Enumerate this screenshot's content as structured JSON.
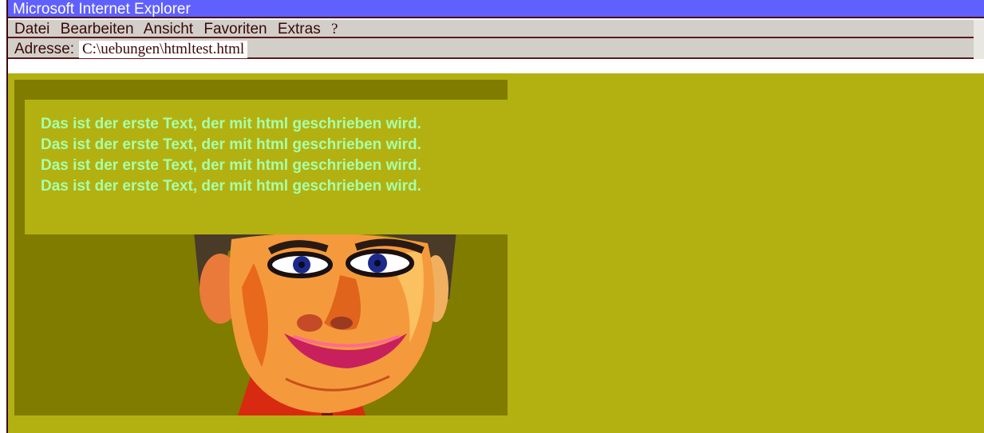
{
  "window": {
    "title": "Microsoft Internet Explorer"
  },
  "menu": [
    "Datei",
    "Bearbeiten",
    "Ansicht",
    "Favoriten",
    "Extras",
    "?"
  ],
  "address": {
    "label": "Adresse:",
    "value": "C:\\uebungen\\htmltest.html"
  },
  "content": {
    "lines": [
      "Das ist der erste Text, der mit html geschrieben wird.",
      "Das ist der erste Text, der mit html geschrieben wird.",
      "Das ist der erste Text, der mit html geschrieben wird.",
      "Das ist der erste Text, der mit html geschrieben wird."
    ]
  },
  "colors": {
    "titlebar": "#6060ff",
    "page_background": "#b2b111",
    "picture_background": "#807c00",
    "text": "#a8ffa8"
  }
}
